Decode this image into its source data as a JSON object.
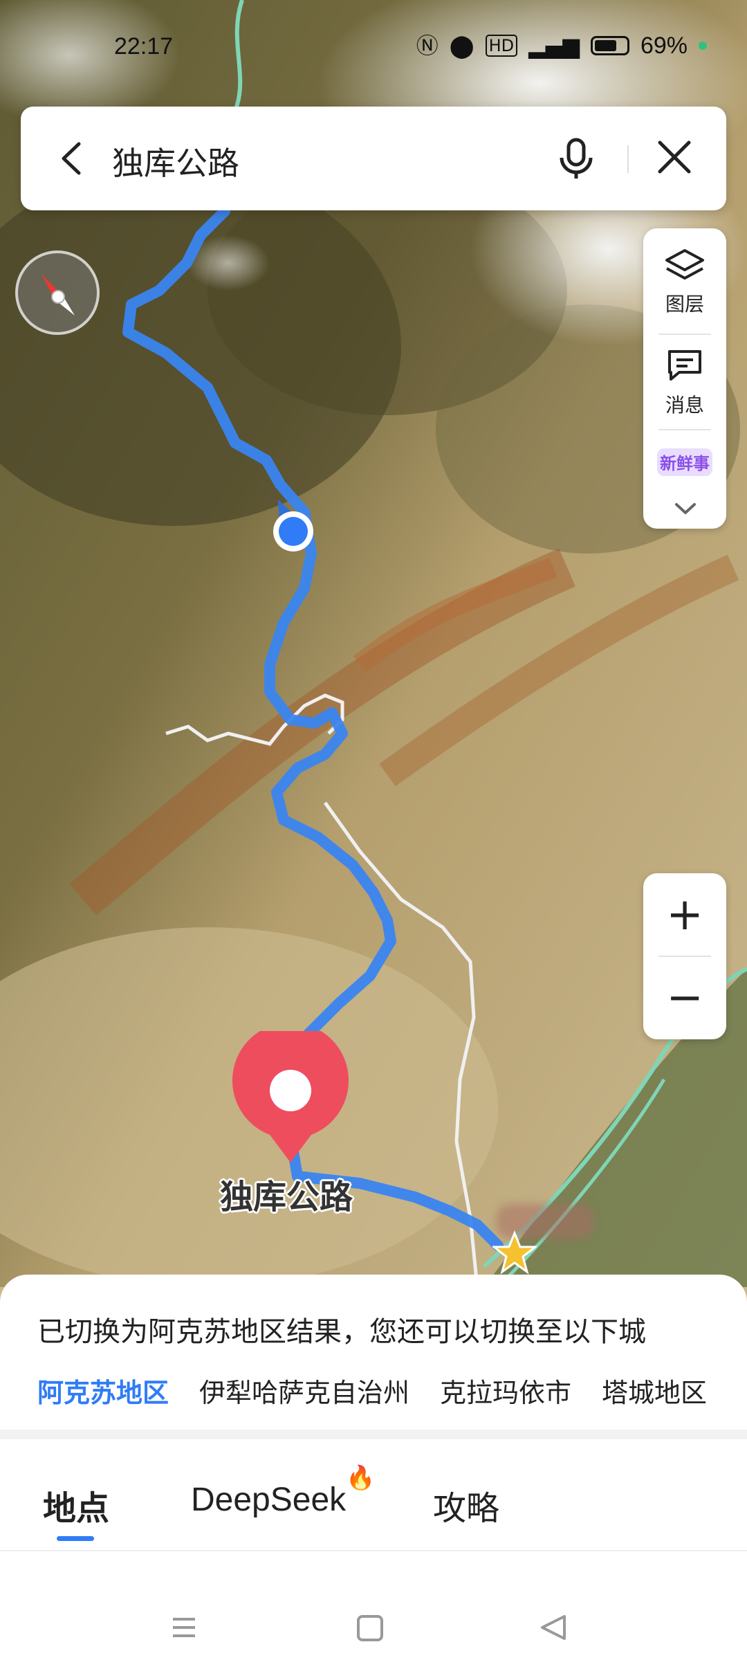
{
  "status": {
    "time": "22:17",
    "battery_text": "69%",
    "battery_level": 0.69,
    "icons": [
      "nfc-icon",
      "location-icon",
      "hd-icon",
      "5g-signal-icon"
    ]
  },
  "search": {
    "query": "独库公路",
    "back_icon": "chevron-left-icon",
    "mic_icon": "microphone-icon",
    "close_icon": "close-icon"
  },
  "side_panel": {
    "layers_label": "图层",
    "messages_label": "消息",
    "news_badge_text": "新鲜事"
  },
  "map": {
    "pin_label": "独库公路",
    "route_color": "#3a85f0",
    "pin_color": "#ee4d5e",
    "location_dot_color": "#2f7cf6"
  },
  "zoom": {
    "plus": "+",
    "minus": "−"
  },
  "sheet": {
    "notice": "已切换为阿克苏地区结果，您还可以切换至以下城",
    "cities": [
      {
        "label": "阿克苏地区",
        "active": true
      },
      {
        "label": "伊犁哈萨克自治州",
        "active": false
      },
      {
        "label": "克拉玛依市",
        "active": false
      },
      {
        "label": "塔城地区",
        "active": false
      }
    ],
    "tabs": [
      {
        "label": "地点",
        "active": true
      },
      {
        "label": "DeepSeek",
        "active": false
      },
      {
        "label": "攻略",
        "active": false
      }
    ]
  },
  "colors": {
    "accent": "#2f7cf6",
    "flame": "#f05a28"
  }
}
